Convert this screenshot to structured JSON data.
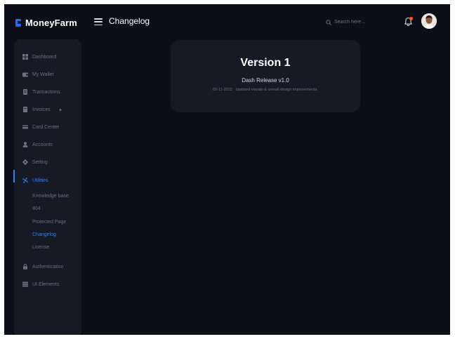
{
  "brand": {
    "name": "MoneyFarm"
  },
  "header": {
    "title": "Changelog",
    "search_placeholder": "Search here...",
    "notification_badge_color": "#ff5a1f"
  },
  "sidebar": {
    "items": [
      {
        "label": "Dashboard",
        "icon": "dashboard-icon"
      },
      {
        "label": "My Wallet",
        "icon": "wallet-icon"
      },
      {
        "label": "Transactions",
        "icon": "receipt-icon"
      },
      {
        "label": "Invoices",
        "icon": "invoice-icon"
      },
      {
        "label": "Card Center",
        "icon": "card-icon"
      },
      {
        "label": "Accounts",
        "icon": "user-icon"
      },
      {
        "label": "Setting",
        "icon": "gear-icon"
      },
      {
        "label": "Utilities",
        "icon": "utilities-icon"
      },
      {
        "label": "Authentication",
        "icon": "lock-icon"
      },
      {
        "label": "UI Elements",
        "icon": "ui-elements-icon"
      }
    ],
    "utilities_sub": [
      {
        "label": "Knowledge base"
      },
      {
        "label": "404"
      },
      {
        "label": "Protected Page"
      },
      {
        "label": "Changelog"
      },
      {
        "label": "License"
      }
    ],
    "active_item": "Utilities",
    "active_sub_item": "Changelog"
  },
  "changelog": {
    "version_title": "Version 1",
    "release_name": "Dash Release v1.0",
    "release_note": "03-11-2022 · Updated visuals & overall design improvements."
  },
  "colors": {
    "accent": "#2f80ff",
    "background": "#0c0f17",
    "panel": "#161a25"
  }
}
